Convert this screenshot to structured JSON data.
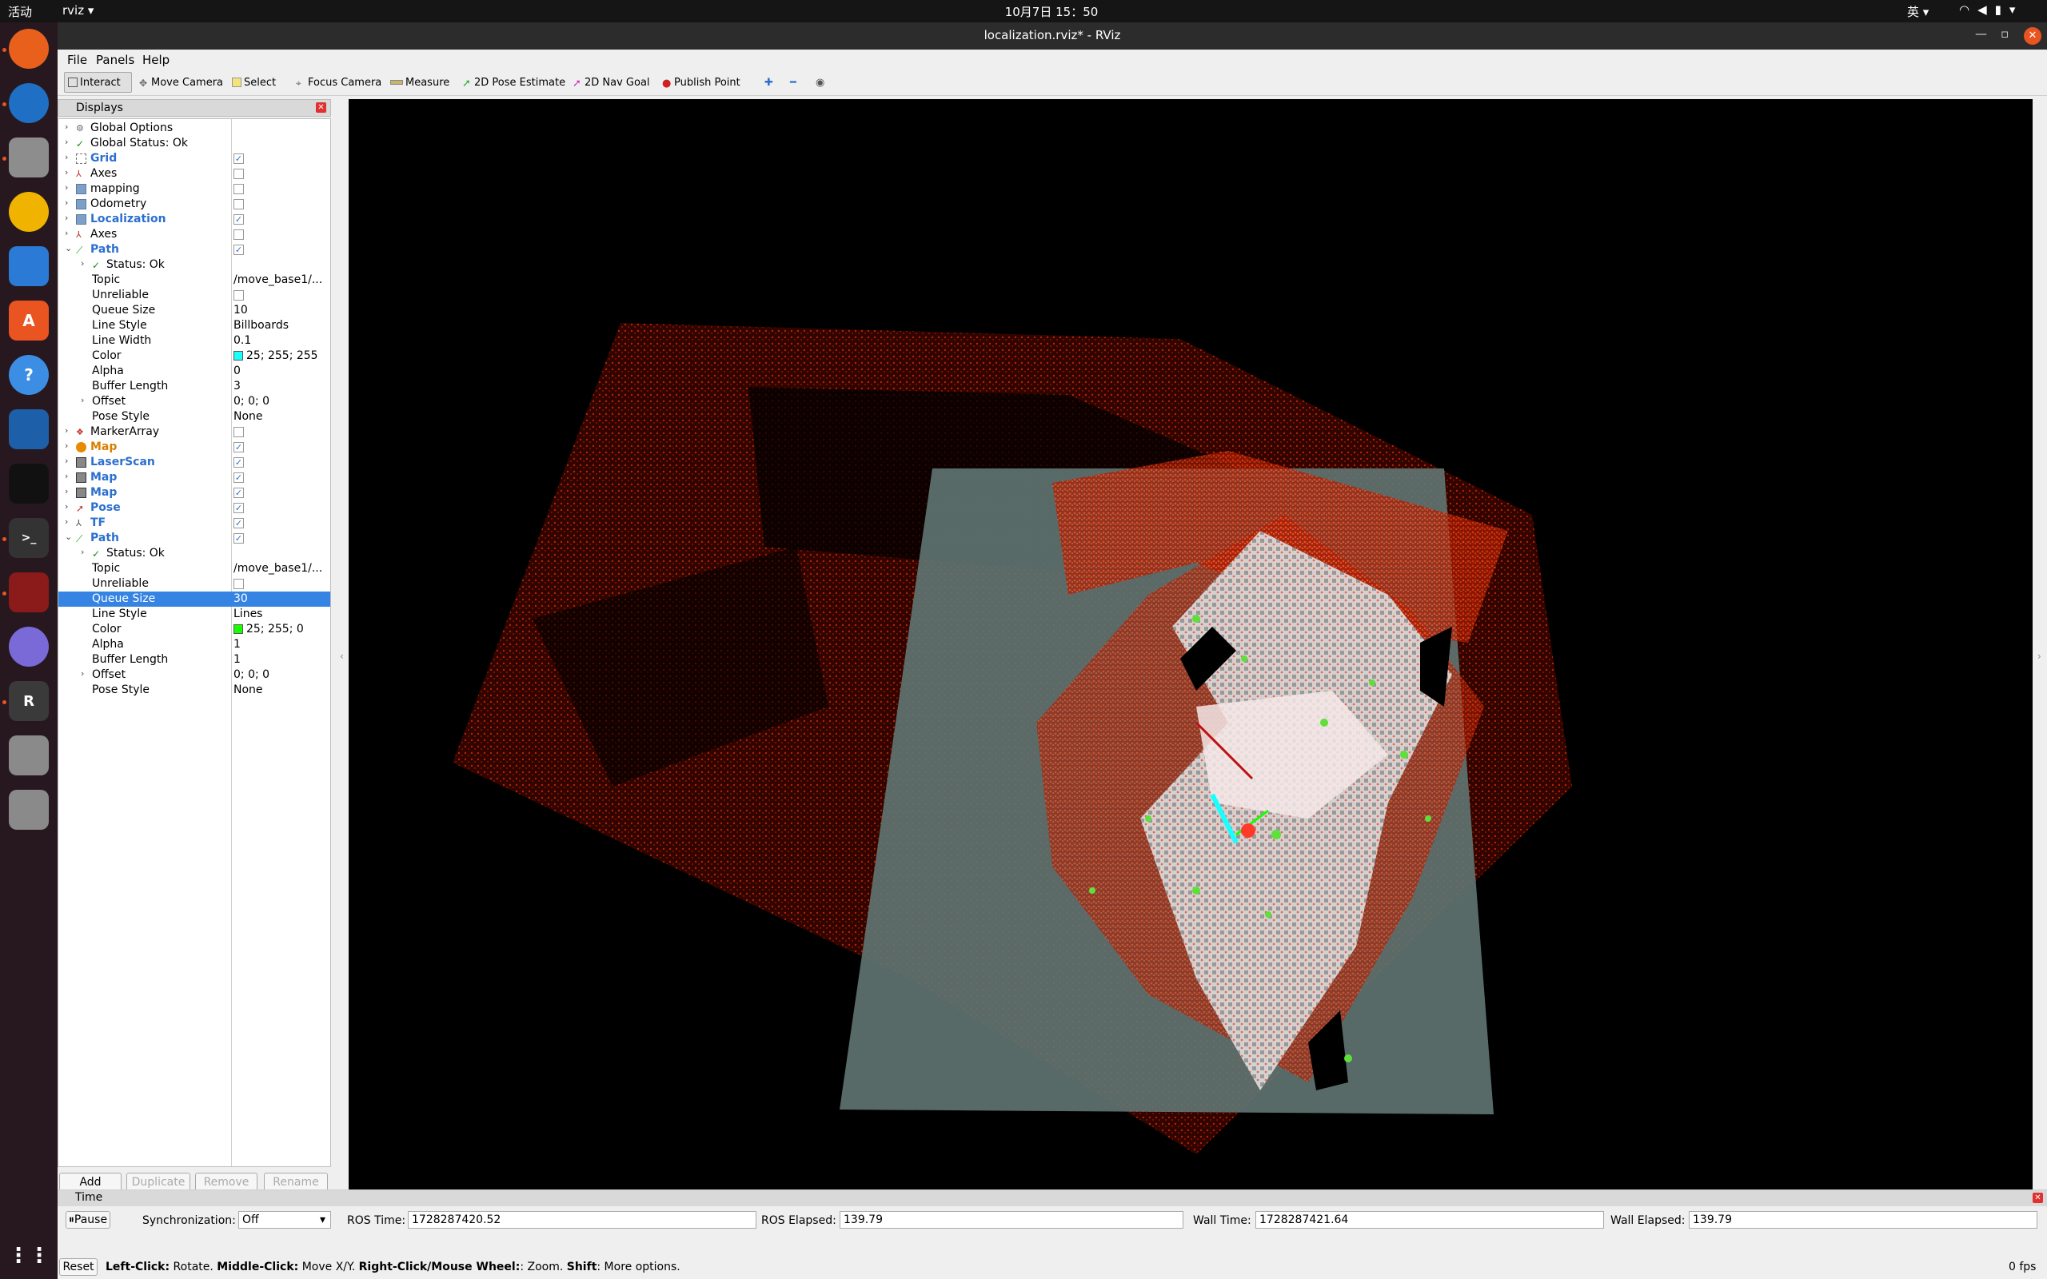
{
  "topbar": {
    "activities": "活动",
    "app": "rviz ▾",
    "clock": "10月7日  15：50",
    "ime": "英 ▾"
  },
  "window": {
    "title": "localization.rviz* - RViz"
  },
  "menu": {
    "file": "File",
    "panels": "Panels",
    "help": "Help"
  },
  "toolbar": {
    "interact": "Interact",
    "move_camera": "Move Camera",
    "select": "Select",
    "focus_camera": "Focus Camera",
    "measure": "Measure",
    "pose_estimate": "2D Pose Estimate",
    "nav_goal": "2D Nav Goal",
    "publish_point": "Publish Point"
  },
  "displays": {
    "title": "Displays",
    "rows": [
      {
        "name": "Global Options"
      },
      {
        "name": "Global Status: Ok"
      },
      {
        "name": "Grid",
        "checked": "✓"
      },
      {
        "name": "Axes",
        "checked": ""
      },
      {
        "name": "mapping",
        "checked": ""
      },
      {
        "name": "Odometry",
        "checked": ""
      },
      {
        "name": "Localization",
        "checked": "✓"
      },
      {
        "name": "Axes",
        "checked": ""
      },
      {
        "name": "Path",
        "checked": "✓"
      },
      {
        "name": "Status: Ok"
      },
      {
        "name": "Topic",
        "value": "/move_base1/..."
      },
      {
        "name": "Unreliable",
        "checked": ""
      },
      {
        "name": "Queue Size",
        "value": "10"
      },
      {
        "name": "Line Style",
        "value": "Billboards"
      },
      {
        "name": "Line Width",
        "value": "0.1"
      },
      {
        "name": "Color",
        "value": "25; 255; 255"
      },
      {
        "name": "Alpha",
        "value": "0"
      },
      {
        "name": "Buffer Length",
        "value": "3"
      },
      {
        "name": "Offset",
        "value": "0; 0; 0"
      },
      {
        "name": "Pose Style",
        "value": "None"
      },
      {
        "name": "MarkerArray",
        "checked": ""
      },
      {
        "name": "Map",
        "checked": "✓"
      },
      {
        "name": "LaserScan",
        "checked": "✓"
      },
      {
        "name": "Map",
        "checked": "✓"
      },
      {
        "name": "Map",
        "checked": "✓"
      },
      {
        "name": "Pose",
        "checked": "✓"
      },
      {
        "name": "TF",
        "checked": "✓"
      },
      {
        "name": "Path",
        "checked": "✓"
      },
      {
        "name": "Status: Ok"
      },
      {
        "name": "Topic",
        "value": "/move_base1/..."
      },
      {
        "name": "Unreliable",
        "checked": ""
      },
      {
        "name": "Queue Size",
        "value": "30"
      },
      {
        "name": "Line Style",
        "value": "Lines"
      },
      {
        "name": "Color",
        "value": "25; 255; 0"
      },
      {
        "name": "Alpha",
        "value": "1"
      },
      {
        "name": "Buffer Length",
        "value": "1"
      },
      {
        "name": "Offset",
        "value": "0; 0; 0"
      },
      {
        "name": "Pose Style",
        "value": "None"
      }
    ],
    "buttons": {
      "add": "Add",
      "duplicate": "Duplicate",
      "remove": "Remove",
      "rename": "Rename"
    }
  },
  "colors": {
    "path1_color": "#19ffff",
    "path2_color": "#19ff00"
  },
  "time": {
    "title": "Time",
    "pause": "Pause",
    "sync_label": "Synchronization:",
    "sync_value": "Off",
    "ros_time_label": "ROS Time:",
    "ros_time": "1728287420.52",
    "ros_elapsed_label": "ROS Elapsed:",
    "ros_elapsed": "139.79",
    "wall_time_label": "Wall Time:",
    "wall_time": "1728287421.64",
    "wall_elapsed_label": "Wall Elapsed:",
    "wall_elapsed": "139.79"
  },
  "status": {
    "reset": "Reset",
    "k1": "Left-Click:",
    "t1": " Rotate. ",
    "k2": "Middle-Click:",
    "t2": " Move X/Y. ",
    "k3": "Right-Click/Mouse Wheel:",
    "t3": ": Zoom. ",
    "k4": "Shift",
    "t4": ": More options.",
    "fps": "0 fps"
  }
}
